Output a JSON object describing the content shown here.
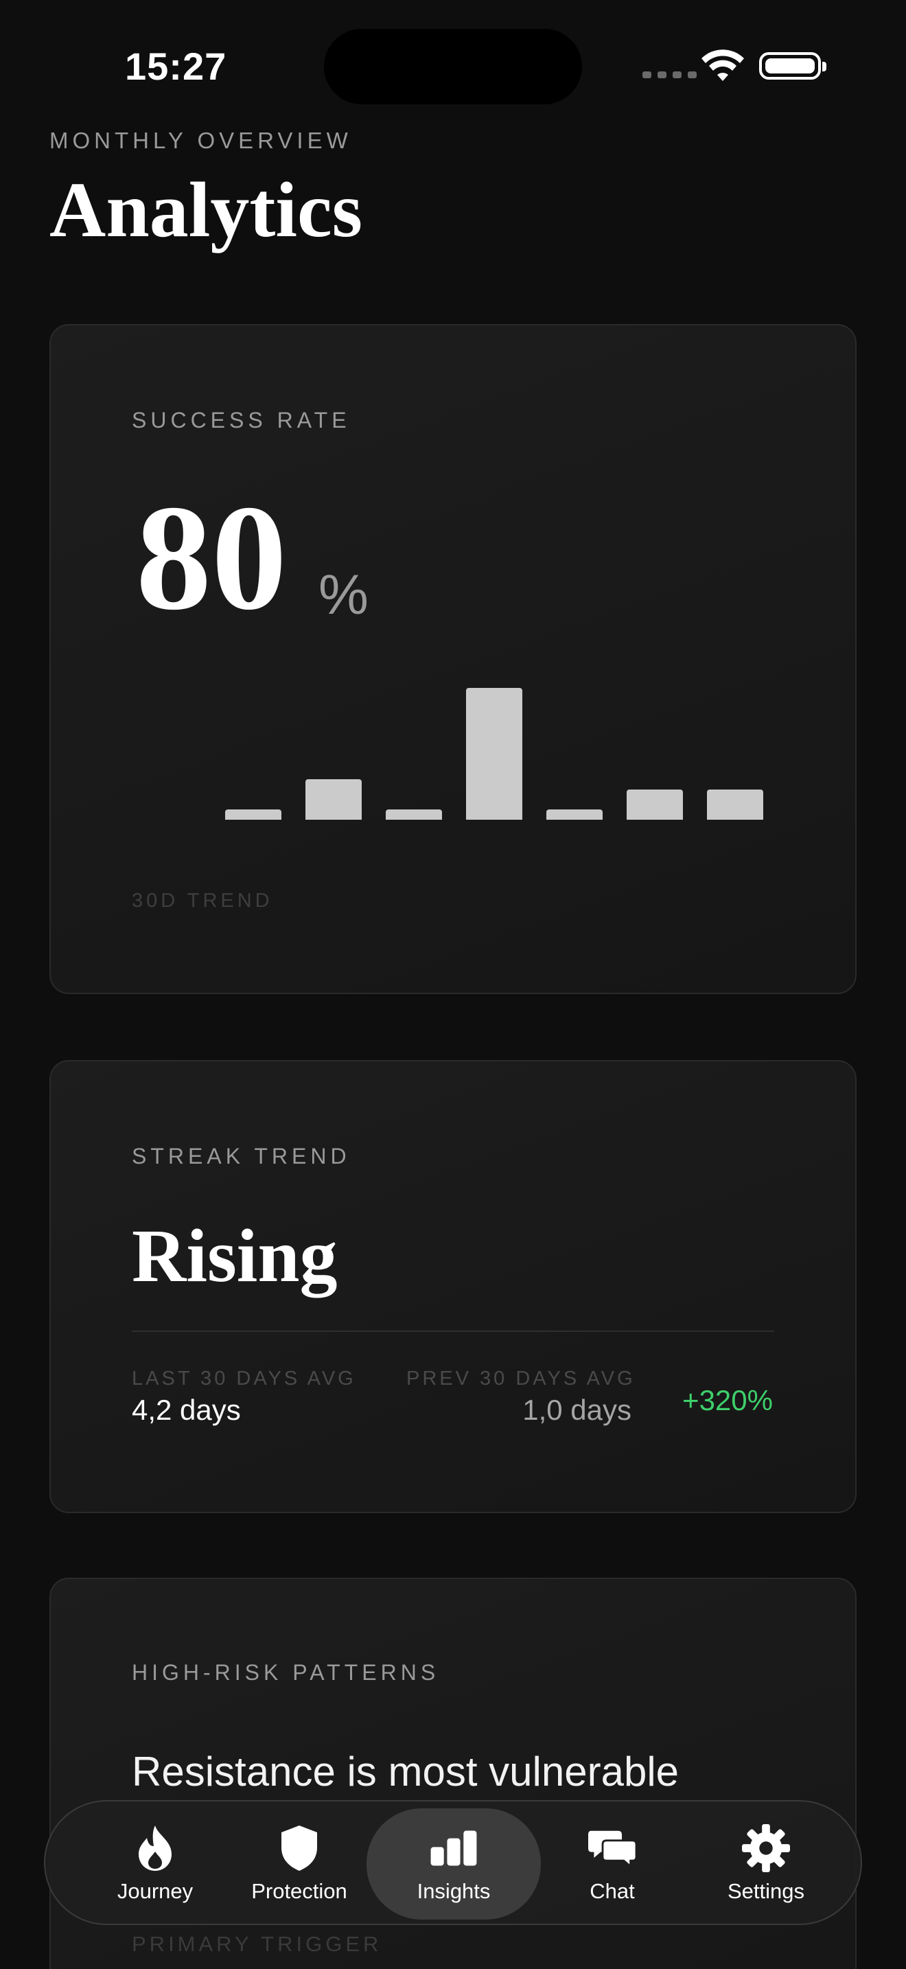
{
  "status_bar": {
    "time": "15:27"
  },
  "header": {
    "eyebrow": "MONTHLY OVERVIEW",
    "title": "Analytics"
  },
  "success_card": {
    "label": "SUCCESS RATE",
    "value": "80",
    "unit": "%",
    "trend_label": "30D TREND",
    "chart_data": {
      "type": "bar",
      "values": [
        1,
        4,
        1,
        13,
        1,
        3,
        3
      ],
      "bar_color": "#cbcbcb"
    }
  },
  "streak_card": {
    "label": "STREAK TREND",
    "status": "Rising",
    "last_label": "LAST 30 DAYS AVG",
    "last_value": "4,2 days",
    "prev_label": "PREV 30 DAYS AVG",
    "prev_value": "1,0 days",
    "delta": "+320%",
    "delta_color": "#3ecf6a"
  },
  "risk_card": {
    "label": "HIGH-RISK PATTERNS",
    "text": "Resistance is most vulnerable",
    "primary_trigger_label": "PRIMARY TRIGGER"
  },
  "tabs": [
    {
      "label": "Journey",
      "icon": "flame-icon"
    },
    {
      "label": "Protection",
      "icon": "shield-icon"
    },
    {
      "label": "Insights",
      "icon": "bar-chart-icon",
      "active": true
    },
    {
      "label": "Chat",
      "icon": "chat-bubbles-icon"
    },
    {
      "label": "Settings",
      "icon": "gear-icon"
    }
  ]
}
